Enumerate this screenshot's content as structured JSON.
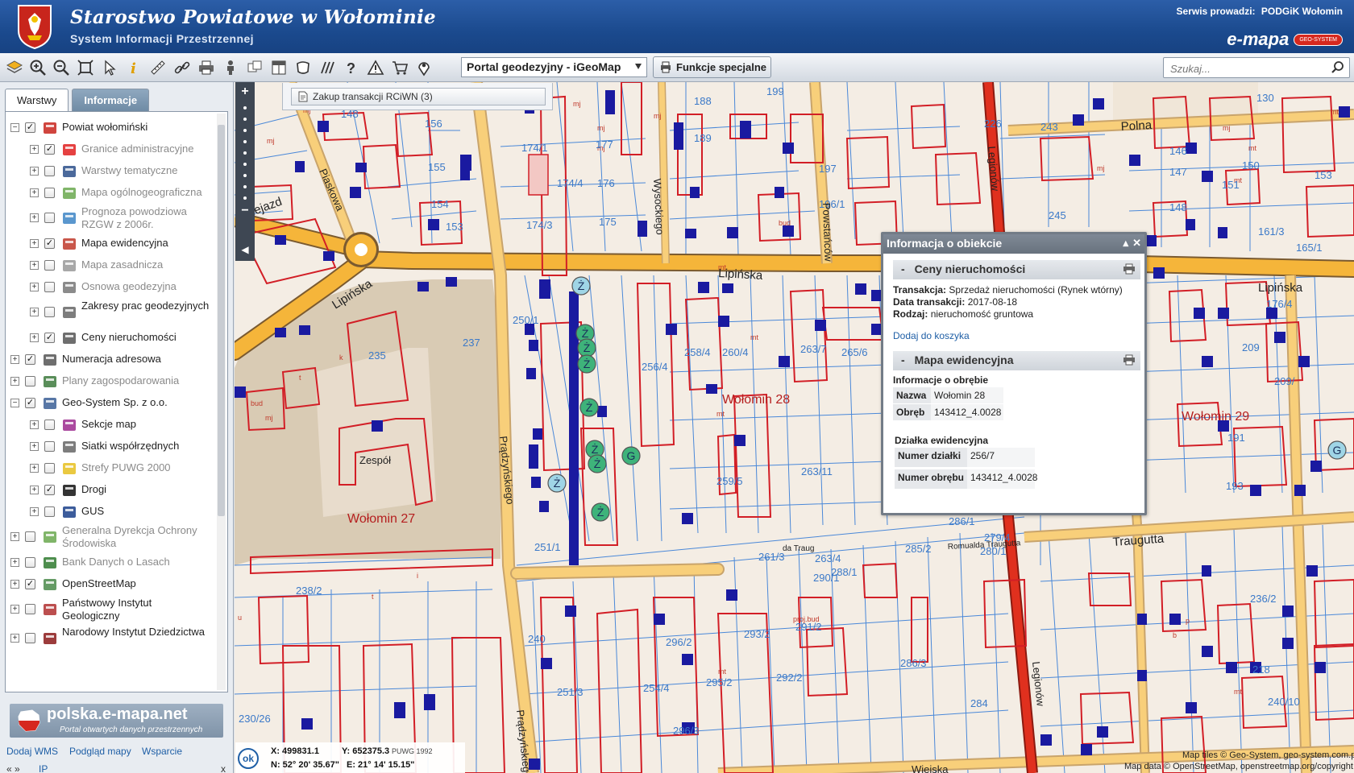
{
  "header": {
    "title": "Starostwo Powiatowe w Wołominie",
    "subtitle": "System Informacji Przestrzennej",
    "served_label": "Serwis prowadzi:",
    "served_by": "PODGiK Wołomin",
    "brand": "e-mapa",
    "brand_badge": "GEO-SYSTEM"
  },
  "toolbar": {
    "portal_select": "Portal geodezyjny - iGeoMap",
    "special_button": "Funkcje specjalne",
    "search_placeholder": "Szukaj..."
  },
  "tabs": [
    {
      "label": "Warstwy",
      "active": true
    },
    {
      "label": "Informacje",
      "active": false
    }
  ],
  "layers": [
    {
      "label": "Powiat wołomiński",
      "expand": "−",
      "checked": true,
      "dim": false,
      "icon": "county-crest-icon"
    },
    {
      "label": "Granice administracyjne",
      "expand": "+",
      "checked": true,
      "dim": true,
      "icon": "boundaries-icon"
    },
    {
      "label": "Warstwy tematyczne",
      "expand": "+",
      "checked": false,
      "dim": true,
      "icon": "stack-layers-icon"
    },
    {
      "label": "Mapa ogólnogeograficzna",
      "expand": "+",
      "checked": false,
      "dim": true,
      "icon": "terrain-map-icon"
    },
    {
      "label": "Prognoza powodziowa RZGW z 2006r.",
      "expand": "+",
      "checked": false,
      "dim": true,
      "icon": "flood-icon"
    },
    {
      "label": "Mapa ewidencyjna",
      "expand": "+",
      "checked": true,
      "dim": false,
      "icon": "cadastre-icon"
    },
    {
      "label": "Mapa zasadnicza",
      "expand": "+",
      "checked": false,
      "dim": true,
      "icon": "base-map-icon"
    },
    {
      "label": "Osnowa geodezyjna",
      "expand": "+",
      "checked": false,
      "dim": true,
      "icon": "geodetic-network-icon"
    },
    {
      "label": "Zakresy prac geodezyjnych",
      "expand": "+",
      "checked": false,
      "dim": false,
      "icon": "survey-work-icon"
    },
    {
      "label": "Ceny nieruchomości",
      "expand": "+",
      "checked": true,
      "dim": false,
      "icon": "property-price-icon"
    },
    {
      "label": "Numeracja adresowa",
      "expand": "+",
      "checked": true,
      "dim": false,
      "icon": "envelope-icon"
    },
    {
      "label": "Plany zagospodarowania",
      "expand": "+",
      "checked": false,
      "dim": true,
      "icon": "zoning-plan-icon"
    },
    {
      "label": "Geo-System Sp. z o.o.",
      "expand": "−",
      "checked": true,
      "dim": false,
      "icon": "globe-icon"
    },
    {
      "label": "Sekcje map",
      "expand": "+",
      "checked": false,
      "dim": false,
      "icon": "map-sections-icon"
    },
    {
      "label": "Siatki współrzędnych",
      "expand": "+",
      "checked": false,
      "dim": false,
      "icon": "coordinate-grid-icon"
    },
    {
      "label": "Strefy PUWG 2000",
      "expand": "+",
      "checked": false,
      "dim": true,
      "icon": "zones-icon"
    },
    {
      "label": "Drogi",
      "expand": "+",
      "checked": true,
      "dim": false,
      "icon": "road-icon"
    },
    {
      "label": "GUS",
      "expand": "+",
      "checked": false,
      "dim": false,
      "icon": "gus-icon"
    },
    {
      "label": "Generalna Dyrekcja Ochrony Środowiska",
      "expand": "+",
      "checked": false,
      "dim": true,
      "icon": "leaf-icon"
    },
    {
      "label": "Bank Danych o Lasach",
      "expand": "+",
      "checked": false,
      "dim": true,
      "icon": "forest-icon"
    },
    {
      "label": "OpenStreetMap",
      "expand": "+",
      "checked": true,
      "dim": false,
      "icon": "magnifier-map-icon"
    },
    {
      "label": "Państwowy Instytut Geologiczny",
      "expand": "+",
      "checked": false,
      "dim": false,
      "icon": "geology-icon"
    },
    {
      "label": "Narodowy Instytut Dziedzictwa",
      "expand": "+",
      "checked": false,
      "dim": false,
      "icon": "heritage-icon"
    }
  ],
  "logo": {
    "big": "polska.e-mapa.net",
    "small": "Portal otwartych danych przestrzennych"
  },
  "footer": {
    "add_wms": "Dodaj WMS",
    "preview": "Podgląd mapy",
    "support": "Wsparcie",
    "arrows": "« »",
    "ip": "IP",
    "close": "x"
  },
  "rciwn": {
    "label": "Zakup transakcji RCiWN (3)"
  },
  "info": {
    "title": "Informacja o obiekcie",
    "section1": "Ceny nieruchomości",
    "transaction_label": "Transakcja:",
    "transaction_value": "Sprzedaż nieruchomości (Rynek wtórny)",
    "date_label": "Data transakcji:",
    "date_value": "2017-08-18",
    "type_label": "Rodzaj:",
    "type_value": "nieruchomość gruntowa",
    "basket_link": "Dodaj do koszyka",
    "section2": "Mapa ewidencyjna",
    "precinct_header": "Informacje o obrębie",
    "name_key": "Nazwa",
    "name_value": "Wołomin 28",
    "precinct_key": "Obręb",
    "precinct_value": "143412_4.0028",
    "parcel_header": "Działka ewidencyjna",
    "parcel_no_key": "Numer działki",
    "parcel_no_value": "256/7",
    "parcel_precinct_key": "Numer obrębu",
    "parcel_precinct_value": "143412_4.0028"
  },
  "coords": {
    "ok": "ok",
    "x": "X: 499831.1",
    "y": "Y: 652375.3",
    "system": "PUWG 1992",
    "n": "N: 52° 20' 35.67\"",
    "e": "E: 21° 14' 15.15\""
  },
  "attribution": {
    "line1": "Map tiles © Geo-System, geo-system.com.pl",
    "line2": "Map data © OpenStreetMap, openstreetmap.org/copyright"
  },
  "map": {
    "streets": [
      "Lipińska",
      "Lipińska",
      "Lipińska",
      "Przejazd",
      "Piaskowa",
      "Wysockiego",
      "Powstańców",
      "Polna",
      "Prądzyńskiego",
      "Prądzyńskiego",
      "Legionów",
      "Legionów",
      "Traugutta",
      "Romualda Traugutta",
      "Wiejska"
    ],
    "districts": [
      "Wołomin 28",
      "Wołomin 27",
      "Wołomin 29"
    ],
    "parcels": [
      "199",
      "188",
      "189",
      "177",
      "176",
      "175",
      "174/1",
      "174/4",
      "174/3",
      "156",
      "155",
      "154",
      "153",
      "148",
      "235",
      "237",
      "226",
      "243",
      "245",
      "130",
      "146",
      "147",
      "148",
      "150",
      "153",
      "151",
      "165/1",
      "176/4",
      "197",
      "196/1",
      "258/4",
      "260/4",
      "263/7",
      "265/6",
      "256/4",
      "259/5",
      "263/11",
      "261/3",
      "263/4",
      "285/2",
      "286/1",
      "279/4",
      "280/1",
      "288/1",
      "290/1",
      "291/2",
      "292/2",
      "295/2",
      "296/2",
      "293/2",
      "254/4",
      "251/3",
      "296/3",
      "284",
      "240",
      "238/2",
      "251/1",
      "250/1",
      "191",
      "193",
      "236/2",
      "218",
      "240/10",
      "286/3",
      "230/26",
      "264",
      "265/1",
      "161/3"
    ]
  }
}
